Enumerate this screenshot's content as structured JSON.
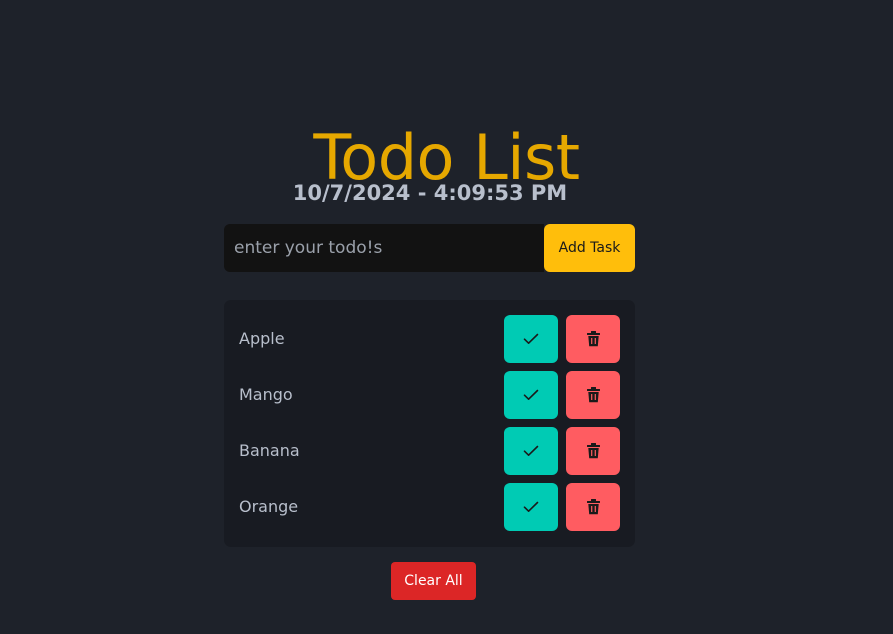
{
  "app": {
    "title": "Todo List",
    "datetime": "10/7/2024 - 4:09:53 PM"
  },
  "form": {
    "input_value": "",
    "input_placeholder": "enter your todo!s",
    "add_label": "Add Task"
  },
  "todos": [
    {
      "label": "Apple"
    },
    {
      "label": "Mango"
    },
    {
      "label": "Banana"
    },
    {
      "label": "Orange"
    }
  ],
  "icons": {
    "check": "check-icon",
    "delete": "trash-icon"
  },
  "actions": {
    "clear_label": "Clear All"
  },
  "colors": {
    "background": "#1e222a",
    "title": "#e6a800",
    "accent_add": "#ffbe0b",
    "check": "#00cbb4",
    "delete": "#ff5c61",
    "clear": "#dc2626"
  }
}
